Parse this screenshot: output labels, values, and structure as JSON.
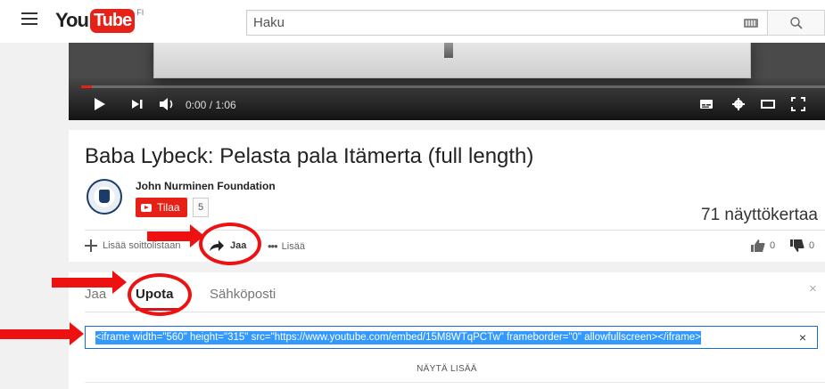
{
  "masthead": {
    "logo_you": "You",
    "logo_tube": "Tube",
    "country_code": "FI",
    "search_placeholder": "Haku"
  },
  "player": {
    "time_display": "0:00 / 1:06",
    "played_fraction": 0.014
  },
  "video": {
    "title": "Baba Lybeck: Pelasta pala Itämerta (full length)",
    "channel_name": "John Nurminen Foundation",
    "subscribe_label": "Tilaa",
    "subscriber_count": "5",
    "view_count": "71 näyttökertaa"
  },
  "actions": {
    "add_to_playlist": "Lisää soittolistaan",
    "share": "Jaa",
    "more": "Lisää",
    "likes": "0",
    "dislikes": "0"
  },
  "share_panel": {
    "tabs": [
      {
        "label": "Jaa",
        "active": false
      },
      {
        "label": "Upota",
        "active": true
      },
      {
        "label": "Sähköposti",
        "active": false
      }
    ],
    "close_label": "×",
    "embed_code": "<iframe width=\"560\" height=\"315\" src=\"https://www.youtube.com/embed/15M8WTqPCTw\" frameborder=\"0\" allowfullscreen></iframe>",
    "clear_label": "×",
    "show_more_label": "NÄYTÄ LISÄÄ"
  },
  "colors": {
    "brand_red": "#e62117",
    "annotation_red": "#ee1111",
    "selection_blue": "#3399ff"
  }
}
